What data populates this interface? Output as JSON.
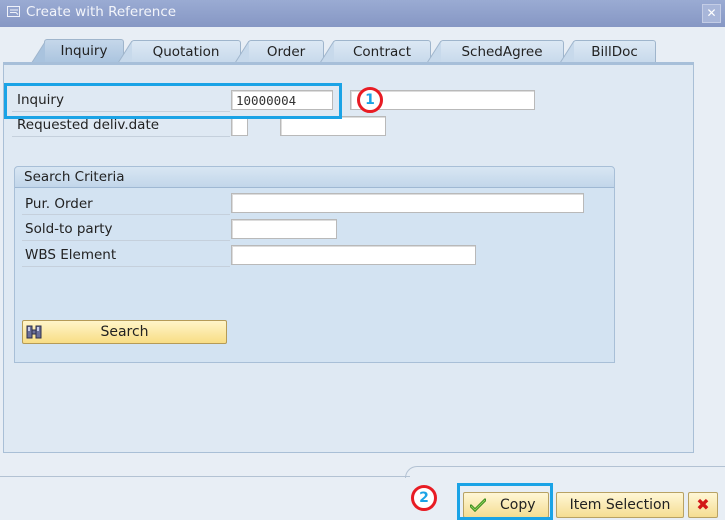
{
  "window": {
    "title": "Create with Reference",
    "title_icon": "create-reference-icon",
    "close_icon": "close-icon",
    "close_glyph": "✕"
  },
  "tabs": [
    {
      "label": "Inquiry",
      "active": true
    },
    {
      "label": "Quotation",
      "active": false
    },
    {
      "label": "Order",
      "active": false
    },
    {
      "label": "Contract",
      "active": false
    },
    {
      "label": "SchedAgree",
      "active": false
    },
    {
      "label": "BillDoc",
      "active": false
    }
  ],
  "form": {
    "inquiry_label": "Inquiry",
    "inquiry_value": "10000004",
    "inquiry_extra_value": "",
    "req_date_label": "Requested deliv.date",
    "req_date_flag_value": "",
    "req_date_value": ""
  },
  "search_criteria": {
    "title": "Search Criteria",
    "fields": [
      {
        "label": "Pur. Order",
        "value": ""
      },
      {
        "label": "Sold-to party",
        "value": ""
      },
      {
        "label": "WBS Element",
        "value": ""
      }
    ],
    "search_button": "Search",
    "search_icon": "binoculars-icon"
  },
  "footer": {
    "copy_button": "Copy",
    "copy_icon": "checkmark-icon",
    "item_selection_button": "Item Selection",
    "cancel_icon": "cancel-x-icon",
    "cancel_glyph": "✖"
  },
  "annotations": {
    "step1": "1",
    "step2": "2",
    "highlight_color": "#1aa3e6",
    "circle_color": "#e81c24"
  }
}
